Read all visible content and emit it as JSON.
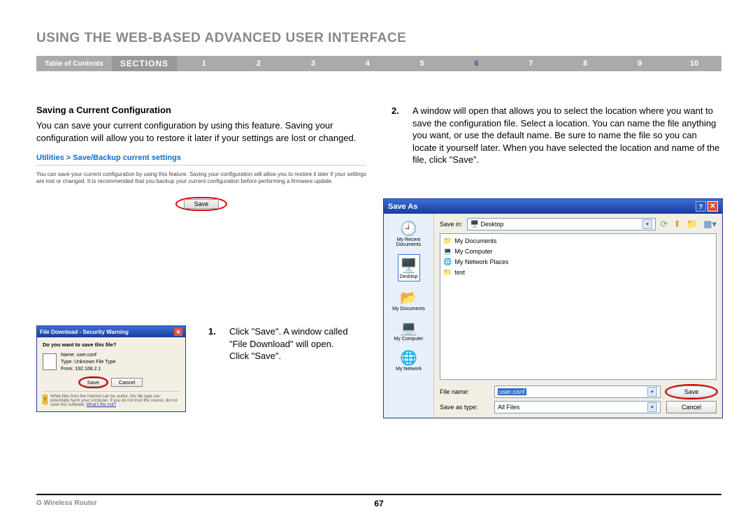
{
  "page_title": "USING THE WEB-BASED ADVANCED USER INTERFACE",
  "nav": {
    "toc": "Table of Contents",
    "sections_label": "SECTIONS",
    "items": [
      "1",
      "2",
      "3",
      "4",
      "5",
      "6",
      "7",
      "8",
      "9",
      "10"
    ],
    "active_index": 5
  },
  "left_col": {
    "heading": "Saving a Current Configuration",
    "para": "You can save your current configuration by using this feature. Saving your configuration will allow you to restore it later if your settings are lost or changed.",
    "util_header": "Utilities > Save/Backup current settings",
    "util_desc": "You can save your current configuration by using this feature. Saving your configuration will allow you to restore it later if your settings are lost or changed. It is recommended that you backup your current configuration before performing a firmware update.",
    "util_save": "Save"
  },
  "step1": {
    "num": "1.",
    "text": "Click \"Save\". A window called \"File Download\" will open. Click \"Save\"."
  },
  "step2": {
    "num": "2.",
    "text": "A window will open that allows you to select the location where you want to save the configuration file. Select a location. You can name the file anything you want, or use the default name. Be sure to name the file so you can locate it yourself later. When you have selected the location and name of the file, click \"Save\"."
  },
  "file_download": {
    "title": "File Download - Security Warning",
    "question": "Do you want to save this file?",
    "name_label": "Name:",
    "name": "user.conf",
    "type_label": "Type:",
    "type": "Unknown File Type",
    "from_label": "From:",
    "from": "192.168.2.1",
    "save": "Save",
    "cancel": "Cancel",
    "warn": "While files from the Internet can be useful, this file type can potentially harm your computer. If you do not trust the source, do not save this software.",
    "whats_risk": "What's the risk?"
  },
  "save_as": {
    "title": "Save As",
    "save_in_label": "Save in:",
    "save_in_value": "Desktop",
    "places": {
      "recent": "My Recent\nDocuments",
      "desktop": "Desktop",
      "mydocs": "My Documents",
      "mycomp": "My Computer",
      "mynet": "My Network"
    },
    "list": [
      {
        "icon": "📁",
        "label": "My Documents"
      },
      {
        "icon": "💻",
        "label": "My Computer"
      },
      {
        "icon": "🌐",
        "label": "My Network Places"
      },
      {
        "icon": "📁",
        "label": "test"
      }
    ],
    "file_name_label": "File name:",
    "file_name_value": "user.conf",
    "save_type_label": "Save as type:",
    "save_type_value": "All Files",
    "save": "Save",
    "cancel": "Cancel"
  },
  "footer": {
    "left": "G Wireless Router",
    "page": "67"
  }
}
